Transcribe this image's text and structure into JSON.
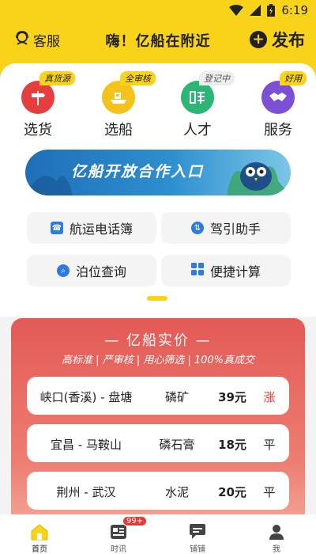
{
  "status_bar": {
    "time": "6:19"
  },
  "header": {
    "customer_service_label": "客服",
    "title": "嗨！亿船在附近",
    "publish_label": "发布",
    "publish_symbol": "+"
  },
  "quick_nav": [
    {
      "label": "选货",
      "badge": "真货源",
      "icon": "signpost-icon",
      "color": "#e53e3e"
    },
    {
      "label": "选船",
      "badge": "全审核",
      "icon": "ship-icon",
      "color": "#f5c21b"
    },
    {
      "label": "人才",
      "badge": "登记中",
      "icon": "hire-icon",
      "color": "#2bb673"
    },
    {
      "label": "服务",
      "badge": "好用",
      "icon": "handshake-icon",
      "color": "#7b4fd6"
    }
  ],
  "banner": {
    "text": "亿船开放合作入口"
  },
  "tools": [
    {
      "label": "航运电话簿",
      "icon": "phone-icon"
    },
    {
      "label": "驾引助手",
      "icon": "pilot-icon"
    },
    {
      "label": "泊位查询",
      "icon": "berth-search-icon"
    },
    {
      "label": "便捷计算",
      "icon": "grid-icon"
    }
  ],
  "price_section": {
    "title": "— 亿船实价 —",
    "subtitle": "高标准 | 严审核 | 用心筛选 | 100%真成交",
    "rows": [
      {
        "route": "峡口(香溪) - 盘塘",
        "cargo": "磷矿",
        "price": "39元",
        "trend": "涨"
      },
      {
        "route": "宜昌 - 马鞍山",
        "cargo": "磷石膏",
        "price": "18元",
        "trend": "平"
      },
      {
        "route": "荆州 - 武汉",
        "cargo": "水泥",
        "price": "20元",
        "trend": "平"
      }
    ]
  },
  "bottom_nav": [
    {
      "label": "首页",
      "icon": "home-icon",
      "active": true
    },
    {
      "label": "时讯",
      "icon": "news-icon",
      "badge": "99+"
    },
    {
      "label": "铺铺",
      "icon": "chat-icon"
    },
    {
      "label": "我",
      "icon": "profile-icon"
    }
  ],
  "colors": {
    "brand_yellow": "#f9d21a",
    "price_red": "#e35a56",
    "up_red": "#e53935"
  }
}
